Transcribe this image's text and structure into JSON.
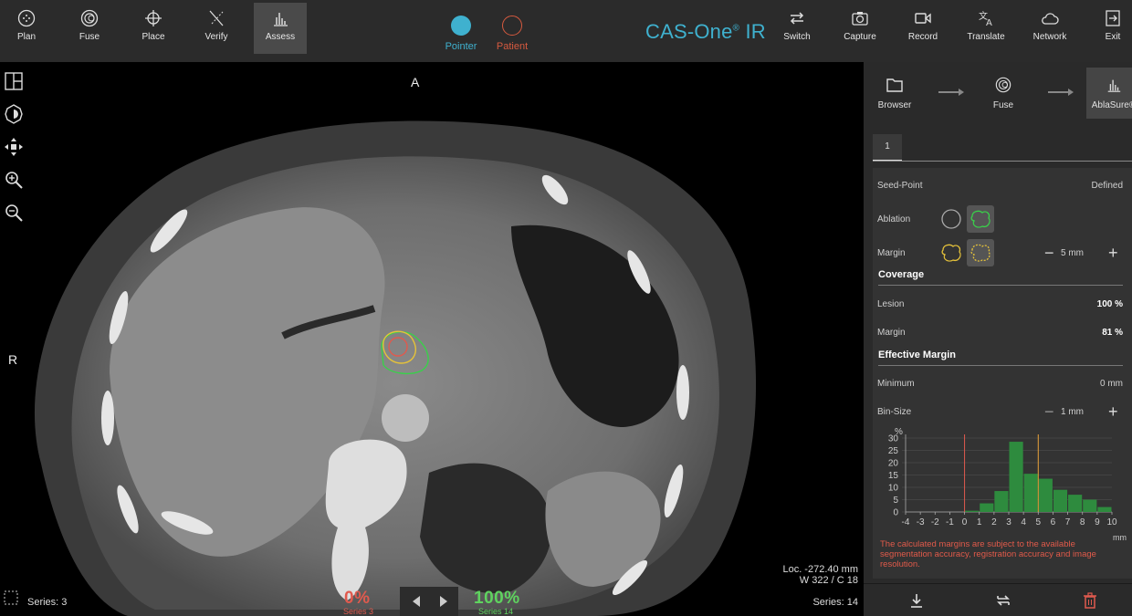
{
  "toolbar": {
    "left_tools": [
      {
        "label": "Plan",
        "icon": "plan-icon"
      },
      {
        "label": "Fuse",
        "icon": "fuse-icon"
      },
      {
        "label": "Place",
        "icon": "place-icon"
      },
      {
        "label": "Verify",
        "icon": "verify-icon"
      },
      {
        "label": "Assess",
        "icon": "assess-icon",
        "active": true
      }
    ],
    "modes": [
      {
        "label": "Pointer",
        "color": "#3fb1cf"
      },
      {
        "label": "Patient",
        "color": "#d65a3f"
      }
    ],
    "brand": "CAS-One",
    "brand_suffix": "IR",
    "right_tools": [
      {
        "label": "Switch",
        "icon": "switch-icon"
      },
      {
        "label": "Capture",
        "icon": "camera-icon"
      },
      {
        "label": "Record",
        "icon": "record-icon"
      },
      {
        "label": "Translate",
        "icon": "translate-icon"
      },
      {
        "label": "Network",
        "icon": "cloud-icon"
      },
      {
        "label": "Exit",
        "icon": "exit-icon"
      }
    ]
  },
  "viewport": {
    "orient_top": "A",
    "orient_left": "R",
    "loc": "Loc. -272.40 mm",
    "window": "W 322 / C 18",
    "series_left": "Series: 3",
    "series_right": "Series: 14",
    "pct_left": "0%",
    "pct_left_sub": "Series 3",
    "pct_right": "100%",
    "pct_right_sub": "Series 14",
    "colors": {
      "pct_left": "#e05a4e",
      "pct_right": "#5fd35f"
    }
  },
  "workflow": {
    "steps": [
      {
        "label": "Browser",
        "icon": "folder-icon"
      },
      {
        "label": "Fuse",
        "icon": "fuse-icon"
      },
      {
        "label": "AblaSure®",
        "icon": "chart-icon",
        "active": true
      }
    ],
    "tab": "1"
  },
  "assess": {
    "seed_point": {
      "label": "Seed-Point",
      "value": "Defined"
    },
    "ablation": {
      "label": "Ablation"
    },
    "margin": {
      "label": "Margin",
      "value": "5 mm"
    },
    "coverage": {
      "heading": "Coverage",
      "lesion_label": "Lesion",
      "lesion_value": "100 %",
      "margin_label": "Margin",
      "margin_value": "81 %"
    },
    "effective_margin": {
      "heading": "Effective Margin",
      "minimum_label": "Minimum",
      "minimum_value": "0 mm",
      "bin_label": "Bin-Size",
      "bin_value": "1 mm"
    },
    "note": "The calculated margins are subject to the available segmentation accuracy, registration accuracy and image resolution."
  },
  "chart_data": {
    "type": "bar",
    "ylabel": "%",
    "xlabel": "mm",
    "ylim": [
      0,
      30
    ],
    "yticks": [
      0,
      5,
      10,
      15,
      20,
      25,
      30
    ],
    "xticks": [
      -4,
      -3,
      -2,
      -1,
      0,
      1,
      2,
      3,
      4,
      5,
      6,
      7,
      8,
      9,
      10
    ],
    "categories": [
      0,
      1,
      2,
      3,
      4,
      5,
      6,
      7,
      8,
      9
    ],
    "values": [
      0.5,
      3.5,
      8.5,
      28.5,
      15.5,
      13.5,
      9,
      7,
      5,
      2
    ],
    "markers": [
      {
        "x": 0,
        "color": "#e05a4e"
      },
      {
        "x": 5,
        "color": "#e8a23a"
      }
    ],
    "bar_color": "#2e8b3e"
  }
}
